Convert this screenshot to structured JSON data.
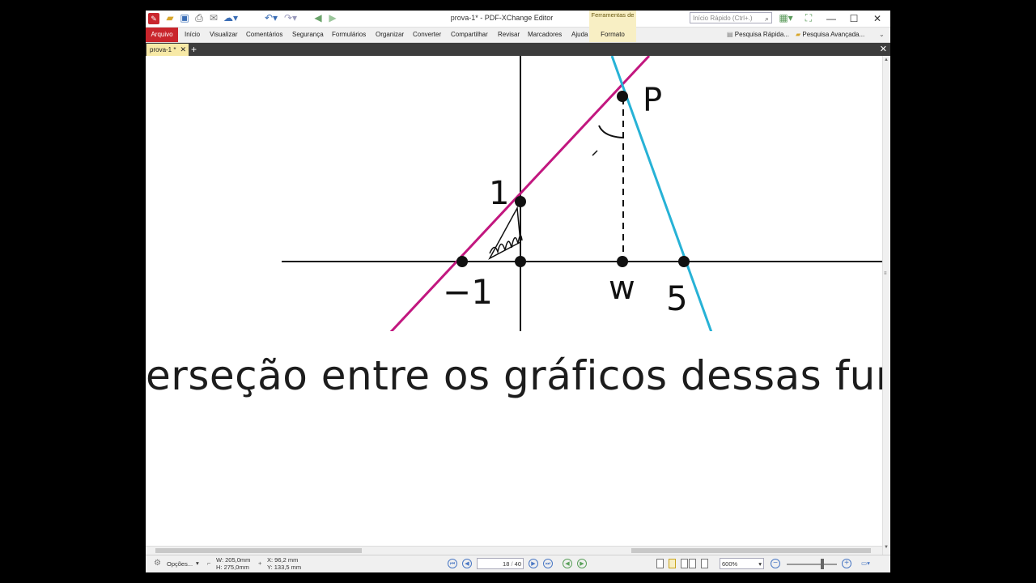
{
  "window": {
    "title": "prova-1* - PDF-XChange Editor",
    "context_tab": "Ferramentas de",
    "context_tab_sub": "Formato",
    "quick_search_placeholder": "Início Rápido (Ctrl+.)",
    "minimize": "—",
    "maximize": "☐",
    "close": "✕"
  },
  "menu": {
    "items": [
      "Arquivo",
      "Início",
      "Visualizar",
      "Comentários",
      "Segurança",
      "Formulários",
      "Organizar",
      "Converter",
      "Compartilhar",
      "Revisar",
      "Marcadores",
      "Ajuda"
    ],
    "formato": "Formato",
    "quick_find": "Pesquisa Rápida...",
    "advanced_find": "Pesquisa Avançada..."
  },
  "tabs": {
    "doc_tab": "prova-1 *",
    "add": "+",
    "close_all": "✕"
  },
  "page": {
    "label_P": "P",
    "label_1": "1",
    "label_minus1": "−1",
    "label_w": "w",
    "label_5": "5",
    "text_line": "erseção entre os gráficos dessas fur"
  },
  "colors": {
    "magenta_line": "#c2177f",
    "cyan_line": "#27b2d6",
    "arquivo_bg": "#c9252c",
    "doc_tab_bg": "#f7e9a6"
  },
  "status": {
    "options": "Opções...",
    "width": "W: 205,0mm",
    "height": "H: 275,0mm",
    "x": "X:  96,2 mm",
    "y": "Y: 133,5 mm",
    "page_current": "18",
    "page_total": "40",
    "zoom": "600%"
  }
}
